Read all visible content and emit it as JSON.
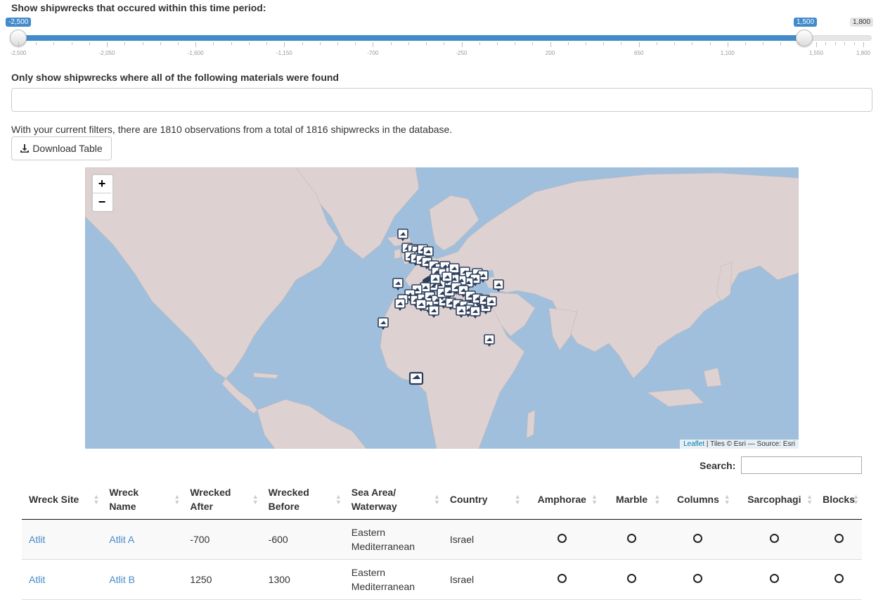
{
  "time_filter": {
    "label": "Show shipwrecks that occured within this time period:",
    "min": -2500,
    "max": 1800,
    "selected_from": -2500,
    "selected_to": 1500,
    "from_label": "-2,500",
    "to_label": "1,500",
    "max_label": "1,800",
    "tick_labels": [
      "-2,500",
      "-2,050",
      "-1,600",
      "-1,150",
      "-700",
      "-250",
      "200",
      "650",
      "1,100",
      "1,550",
      "1,800"
    ]
  },
  "materials_filter": {
    "label": "Only show shipwrecks where all of the following materials were found",
    "value": ""
  },
  "summary": {
    "text": "With your current filters, there are 1810 observations from a total of 1816 shipwrecks in the database."
  },
  "download_button": {
    "label": "Download Table",
    "icon": "download-icon"
  },
  "map": {
    "zoom_in": "+",
    "zoom_out": "−",
    "attribution_link": "Leaflet",
    "attribution_text": " | Tiles © Esri — Source: Esri",
    "colors": {
      "water": "#9fbfdc",
      "land": "#ddd1d1",
      "marker": "#2c3e5a"
    }
  },
  "search": {
    "label": "Search:",
    "value": ""
  },
  "table": {
    "headers": [
      "Wreck Site",
      "Wreck Name",
      "Wrecked After",
      "Wrecked Before",
      "Sea Area/ Waterway",
      "Country",
      "Amphorae",
      "Marble",
      "Columns",
      "Sarcophagi",
      "Blocks"
    ],
    "rows": [
      {
        "site": "Atlit",
        "name": "Atlit A",
        "after": "-700",
        "before": "-600",
        "sea": "Eastern Mediterranean",
        "country": "Israel",
        "amphorae": false,
        "marble": false,
        "columns": false,
        "sarcophagi": false,
        "blocks": false
      },
      {
        "site": "Atlit",
        "name": "Atlit B",
        "after": "1250",
        "before": "1300",
        "sea": "Eastern Mediterranean",
        "country": "Israel",
        "amphorae": false,
        "marble": false,
        "columns": false,
        "sarcophagi": false,
        "blocks": false
      }
    ]
  }
}
